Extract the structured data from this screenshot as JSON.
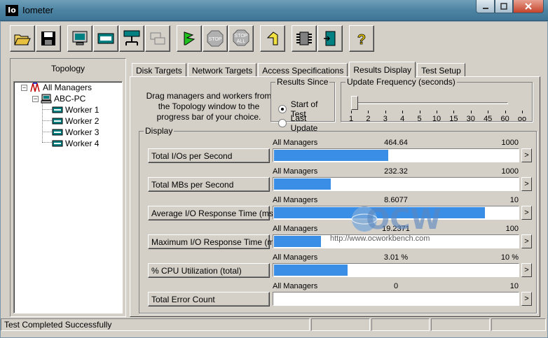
{
  "window": {
    "title": "Iometer",
    "icon_text": "Io"
  },
  "toolbar": {
    "icons": [
      "open-icon",
      "save-icon",
      "display-icon",
      "disk-icon",
      "network-icon",
      "worker-icon",
      "start-icon",
      "stop-icon",
      "stop-all-icon",
      "reset-icon",
      "config-icon",
      "exit-icon",
      "help-icon"
    ],
    "stop_label": "STOP",
    "stop_all_label_top": "STOP",
    "stop_all_label_bottom": "ALL",
    "help_label": "?"
  },
  "topology": {
    "title": "Topology",
    "root": "All Managers",
    "manager": "ABC-PC",
    "workers": [
      "Worker 1",
      "Worker 2",
      "Worker 3",
      "Worker 4"
    ]
  },
  "tabs": [
    "Disk Targets",
    "Network Targets",
    "Access Specifications",
    "Results Display",
    "Test Setup"
  ],
  "active_tab": "Results Display",
  "instructions": "Drag managers and workers from the Topology window to the progress bar of your choice.",
  "results_since": {
    "title": "Results Since",
    "options": [
      "Start of Test",
      "Last Update"
    ],
    "selected": "Start of Test"
  },
  "update_frequency": {
    "title": "Update Frequency (seconds)",
    "ticks": [
      "1",
      "2",
      "3",
      "4",
      "5",
      "10",
      "15",
      "30",
      "45",
      "60",
      "oo"
    ],
    "selected_index": 0
  },
  "display": {
    "title": "Display",
    "metrics": [
      {
        "button": "Total I/Os per Second",
        "source": "All Managers",
        "value": "464.64",
        "max": "1000",
        "fraction": 0.4646
      },
      {
        "button": "Total MBs per Second",
        "source": "All Managers",
        "value": "232.32",
        "max": "1000",
        "fraction": 0.2323
      },
      {
        "button": "Average I/O Response Time (ms)",
        "source": "All Managers",
        "value": "8.6077",
        "max": "10",
        "fraction": 0.8608
      },
      {
        "button": "Maximum I/O Response Time (ms)",
        "source": "All Managers",
        "value": "19.2371",
        "max": "100",
        "fraction": 0.1924
      },
      {
        "button": "% CPU Utilization (total)",
        "source": "All Managers",
        "value": "3.01 %",
        "max": "10 %",
        "fraction": 0.301
      },
      {
        "button": "Total Error Count",
        "source": "All Managers",
        "value": "0",
        "max": "10",
        "fraction": 0
      }
    ],
    "arrow_label": ">"
  },
  "watermark": {
    "logo_text": "OCW",
    "url": "http://www.ocworkbench.com"
  },
  "status": {
    "text": "Test Completed Successfully"
  },
  "colors": {
    "bar": "#3a8ee6",
    "titlebar": "#4d84a3",
    "face": "#d4d0c8"
  }
}
